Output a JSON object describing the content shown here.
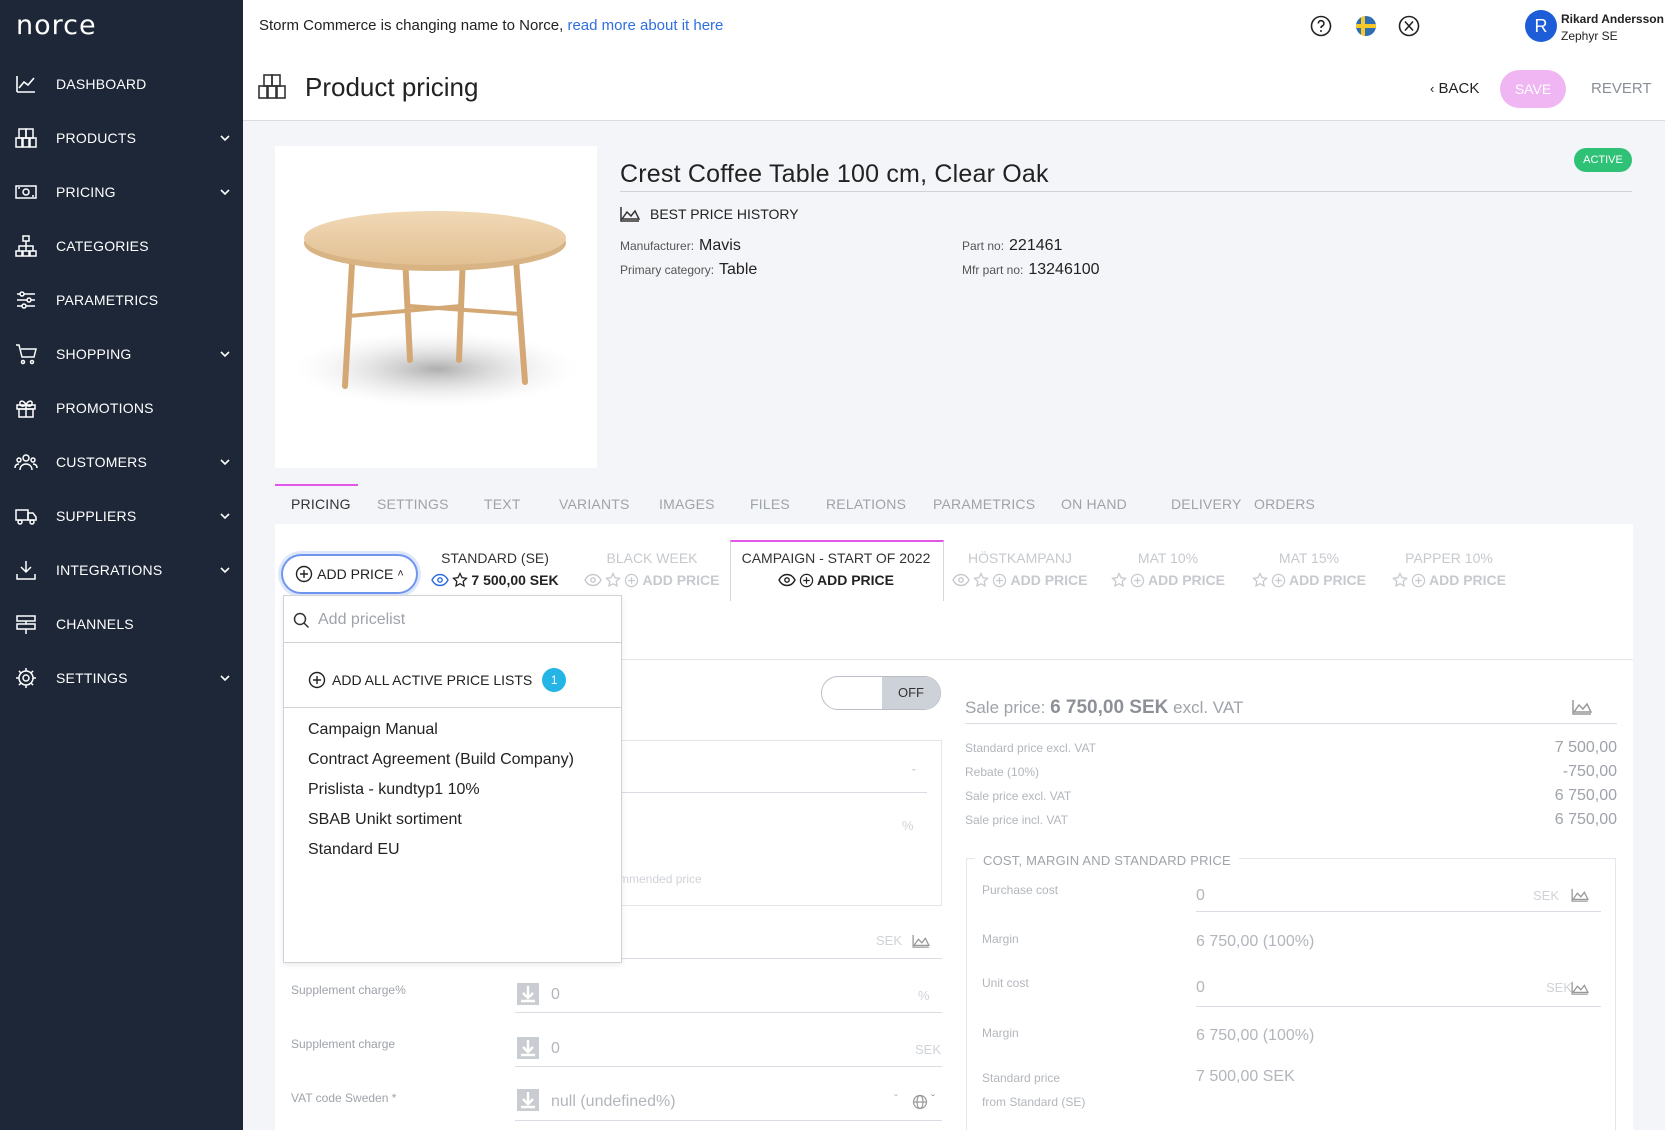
{
  "app": {
    "logo": "norce"
  },
  "sidebar": {
    "items": [
      {
        "label": "DASHBOARD",
        "icon": "chart-icon",
        "chevron": false
      },
      {
        "label": "PRODUCTS",
        "icon": "boxes-icon",
        "chevron": true
      },
      {
        "label": "PRICING",
        "icon": "money-icon",
        "chevron": true
      },
      {
        "label": "CATEGORIES",
        "icon": "hierarchy-icon",
        "chevron": false
      },
      {
        "label": "PARAMETRICS",
        "icon": "sliders-icon",
        "chevron": false
      },
      {
        "label": "SHOPPING",
        "icon": "cart-icon",
        "chevron": true
      },
      {
        "label": "PROMOTIONS",
        "icon": "gift-icon",
        "chevron": false
      },
      {
        "label": "CUSTOMERS",
        "icon": "users-icon",
        "chevron": true
      },
      {
        "label": "SUPPLIERS",
        "icon": "truck-icon",
        "chevron": true
      },
      {
        "label": "INTEGRATIONS",
        "icon": "download-icon",
        "chevron": true
      },
      {
        "label": "CHANNELS",
        "icon": "signpost-icon",
        "chevron": false
      },
      {
        "label": "SETTINGS",
        "icon": "gear-icon",
        "chevron": true
      }
    ]
  },
  "topbar": {
    "notice_text": "Storm Commerce is changing name to Norce, ",
    "notice_link": "read more about it here",
    "user_initial": "R",
    "user_name": "Rikard Andersson",
    "user_company": "Zephyr SE"
  },
  "header": {
    "title": "Product pricing",
    "back_label": "BACK",
    "save_label": "SAVE",
    "revert_label": "REVERT"
  },
  "product": {
    "name": "Crest Coffee Table 100 cm, Clear Oak",
    "status": "ACTIVE",
    "best_price_history": "BEST PRICE HISTORY",
    "manufacturer_label": "Manufacturer:",
    "manufacturer": "Mavis",
    "primary_category_label": "Primary category:",
    "primary_category": "Table",
    "part_no_label": "Part no:",
    "part_no": "221461",
    "mfr_part_no_label": "Mfr part no:",
    "mfr_part_no": "13246100"
  },
  "tabs": [
    "PRICING",
    "SETTINGS",
    "TEXT",
    "VARIANTS",
    "IMAGES",
    "FILES",
    "RELATIONS",
    "PARAMETRICS",
    "ON HAND",
    "DELIVERY",
    "ORDERS"
  ],
  "pricelists": {
    "add_price_label": "ADD PRICE",
    "columns": [
      {
        "name": "STANDARD (SE)",
        "action": "7 500,00 SEK"
      },
      {
        "name": "BLACK WEEK",
        "action": "ADD PRICE"
      },
      {
        "name": "CAMPAIGN - START OF 2022",
        "action": "ADD PRICE"
      },
      {
        "name": "HÖSTKAMPANJ",
        "action": "ADD PRICE"
      },
      {
        "name": "MAT 10%",
        "action": "ADD PRICE"
      },
      {
        "name": "MAT 15%",
        "action": "ADD PRICE"
      },
      {
        "name": "PAPPER 10%",
        "action": "ADD PRICE"
      }
    ]
  },
  "dropdown": {
    "search_placeholder": "Add pricelist",
    "add_all_label": "ADD ALL ACTIVE PRICE LISTS",
    "add_all_count": "1",
    "items": [
      "Campaign Manual",
      "Contract Agreement (Build Company)",
      "Prislista - kundtyp1 10%",
      "SBAB Unikt sortiment",
      "Standard EU"
    ]
  },
  "form": {
    "toggle_label": "OFF",
    "recommended_fragment": "mmended price",
    "currency": "SEK",
    "percent_symbol": "%",
    "supplement_pct_label": "Supplement charge%",
    "supplement_pct_value": "0",
    "supplement_label": "Supplement charge",
    "supplement_value": "0",
    "vat_label": "VAT code Sweden *",
    "vat_value": "null (undefined%)"
  },
  "summary": {
    "sale_price_label": "Sale price:",
    "sale_price_value": "6 750,00 SEK",
    "sale_price_suffix": "excl. VAT",
    "rows": [
      {
        "label": "Standard price excl. VAT",
        "value": "7 500,00"
      },
      {
        "label": "Rebate (10%)",
        "value": "-750,00"
      },
      {
        "label": "Sale price excl. VAT",
        "value": "6 750,00"
      },
      {
        "label": "Sale price incl. VAT",
        "value": "6 750,00"
      }
    ],
    "cost_section_title": "COST, MARGIN AND STANDARD PRICE",
    "purchase_cost_label": "Purchase cost",
    "purchase_cost_value": "0",
    "margin_label": "Margin",
    "margin_value": "6 750,00 (100%)",
    "unit_cost_label": "Unit cost",
    "unit_cost_value": "0",
    "margin2_label": "Margin",
    "margin2_value": "6 750,00 (100%)",
    "standard_price_label": "Standard price",
    "standard_price_sub": "from Standard (SE)",
    "standard_price_value": "7 500,00 SEK"
  },
  "colors": {
    "sidebar_bg": "#1d2738",
    "accent_pink": "#e158e8",
    "active_green": "#2fc276",
    "link_blue": "#2f6fe0",
    "count_badge": "#24b5e6"
  }
}
